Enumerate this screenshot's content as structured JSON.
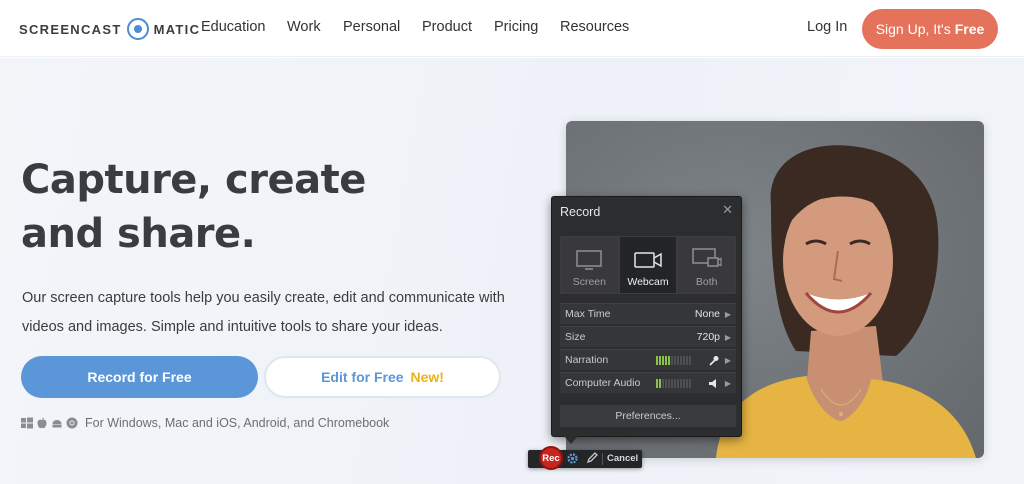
{
  "nav": {
    "logo_left": "SCREENCAST",
    "logo_right": "MATIC",
    "links": [
      "Education",
      "Work",
      "Personal",
      "Product",
      "Pricing",
      "Resources"
    ],
    "login": "Log In",
    "signup_prefix": "Sign Up, It's",
    "signup_free": "Free"
  },
  "hero": {
    "headline": "Capture, create and share.",
    "subtext": "Our screen capture tools help you easily create, edit and communicate with videos and images. Simple and intuitive tools to share your ideas.",
    "record_button": "Record for Free",
    "edit_button": "Edit for Free",
    "edit_badge": "New!",
    "platforms_text": "For Windows, Mac and iOS, Android, and Chromebook",
    "platform_icons": [
      "windows-icon",
      "apple-icon",
      "android-icon",
      "chrome-icon"
    ]
  },
  "recorder": {
    "title": "Record",
    "modes": [
      {
        "label": "Screen",
        "active": false
      },
      {
        "label": "Webcam",
        "active": true
      },
      {
        "label": "Both",
        "active": false
      }
    ],
    "options": [
      {
        "label": "Max Time",
        "value": "None"
      },
      {
        "label": "Size",
        "value": "720p"
      },
      {
        "label": "Narration",
        "value": ""
      },
      {
        "label": "Computer Audio",
        "value": ""
      }
    ],
    "narration_level": 0.5,
    "computer_audio_level": 0.17,
    "preferences": "Preferences...",
    "rec_button": "Rec",
    "cancel": "Cancel"
  },
  "colors": {
    "brand_blue": "#5b97d8",
    "signup_orange": "#e5735b",
    "new_badge": "#e8b21c",
    "rec_red": "#c9251f"
  }
}
